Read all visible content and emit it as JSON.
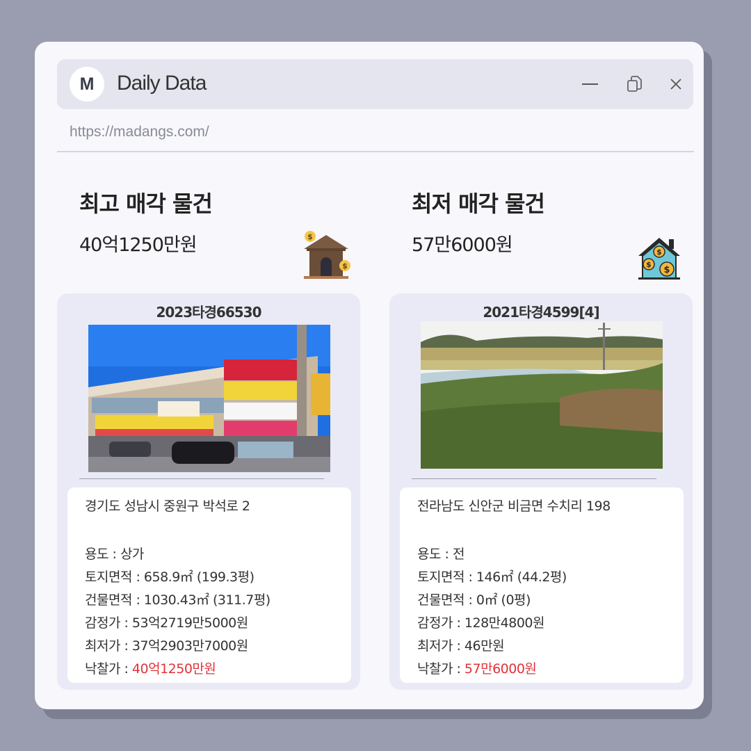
{
  "window": {
    "avatar_letter": "M",
    "title": "Daily Data",
    "url": "https://madangs.com/"
  },
  "highest": {
    "heading": "최고 매각 물건",
    "amount": "40억1250만원",
    "icon": "house-money-icon",
    "case_no": "2023타경66530",
    "address": "경기도 성남시 중원구 박석로 2",
    "rows": [
      {
        "label": "용도 : ",
        "value": "상가"
      },
      {
        "label": "토지면적 : ",
        "value": "658.9㎡ (199.3평)"
      },
      {
        "label": "건물면적 : ",
        "value": "1030.43㎡ (311.7평)"
      },
      {
        "label": "감정가 : ",
        "value": "53억2719만5000원"
      },
      {
        "label": "최저가 : ",
        "value": "37억2903만7000원"
      },
      {
        "label": "낙찰가 : ",
        "value": "40억1250만원"
      }
    ]
  },
  "lowest": {
    "heading": "최저 매각 물건",
    "amount": "57만6000원",
    "icon": "house-coins-icon",
    "case_no": "2021타경4599[4]",
    "address": "전라남도 신안군 비금면 수치리 198",
    "rows": [
      {
        "label": "용도 : ",
        "value": "전"
      },
      {
        "label": "토지면적 : ",
        "value": "146㎡ (44.2평)"
      },
      {
        "label": "건물면적 : ",
        "value": "0㎡ (0평)"
      },
      {
        "label": "감정가 : ",
        "value": "128만4800원"
      },
      {
        "label": "최저가 : ",
        "value": "46만원"
      },
      {
        "label": "낙찰가 : ",
        "value": "57만6000원"
      }
    ]
  },
  "colors": {
    "background": "#9a9cb0",
    "window": "#f7f7fc",
    "card": "#e9eaf5",
    "highlight": "#e2323a"
  }
}
